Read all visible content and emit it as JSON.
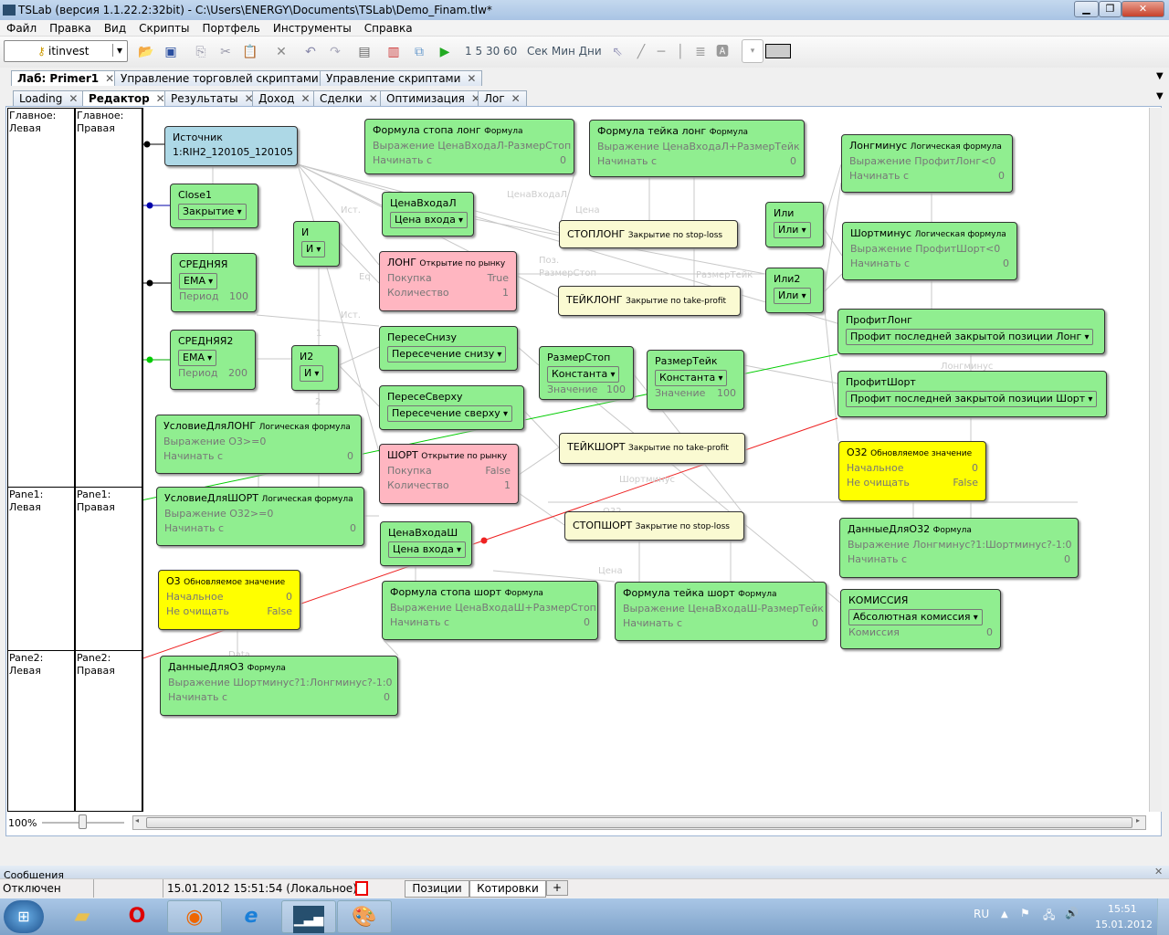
{
  "window": {
    "title": "TSLab (версия 1.1.22.2:32bit) - C:\\Users\\ENERGY\\Documents\\TSLab\\Demo_Finam.tlw*"
  },
  "menu": [
    "Файл",
    "Правка",
    "Вид",
    "Скрипты",
    "Портфель",
    "Инструменты",
    "Справка"
  ],
  "toolbar": {
    "broker": "itinvest",
    "intervals": [
      "1",
      "5",
      "30",
      "60"
    ],
    "units": [
      "Сек",
      "Мин",
      "Дни"
    ]
  },
  "doc_tabs": [
    {
      "label": "Лаб: Primer1",
      "active": true
    },
    {
      "label": "Управление торговлей скриптами"
    },
    {
      "label": "Управление скриптами"
    }
  ],
  "sub_tabs": [
    {
      "label": "Loading"
    },
    {
      "label": "Редактор",
      "active": true
    },
    {
      "label": "Результаты"
    },
    {
      "label": "Доход"
    },
    {
      "label": "Сделки"
    },
    {
      "label": "Оптимизация"
    },
    {
      "label": "Лог"
    }
  ],
  "panes": [
    {
      "title": "Главное:",
      "side": "Левая"
    },
    {
      "title": "Главное:",
      "side": "Правая"
    },
    {
      "title": "Pane1:",
      "side": "Левая"
    },
    {
      "title": "Pane1:",
      "side": "Правая"
    },
    {
      "title": "Pane2:",
      "side": "Левая"
    },
    {
      "title": "Pane2:",
      "side": "Правая"
    }
  ],
  "nodes": [
    {
      "id": "src",
      "kind": "blue",
      "title": "Источник",
      "lines": [
        "1:RIH2_120105_120105"
      ]
    },
    {
      "id": "close1",
      "kind": "green",
      "title": "Close1",
      "dropdown": "Закрытие"
    },
    {
      "id": "sred",
      "kind": "green",
      "title": "СРЕДНЯЯ",
      "dropdown": "EMA",
      "props": [
        [
          "Период",
          "100"
        ]
      ]
    },
    {
      "id": "sred2",
      "kind": "green",
      "title": "СРЕДНЯЯ2",
      "dropdown": "EMA",
      "props": [
        [
          "Период",
          "200"
        ]
      ]
    },
    {
      "id": "i",
      "kind": "green",
      "title": "И",
      "dropdown": "И"
    },
    {
      "id": "i2",
      "kind": "green",
      "title": "И2",
      "dropdown": "И"
    },
    {
      "id": "cenaVL",
      "kind": "green",
      "title": "ЦенаВходаЛ",
      "dropdown": "Цена входа"
    },
    {
      "id": "long",
      "kind": "pink",
      "title": "ЛОНГ",
      "sub": "Открытие по рынку",
      "props": [
        [
          "Покупка",
          "True"
        ],
        [
          "Количество",
          "1"
        ]
      ]
    },
    {
      "id": "pereSn",
      "kind": "green",
      "title": "ПересеСнизу",
      "dropdown": "Пересечение снизу"
    },
    {
      "id": "pereSv",
      "kind": "green",
      "title": "ПересеСверху",
      "dropdown": "Пересечение сверху"
    },
    {
      "id": "usLong",
      "kind": "green",
      "title": "УсловиеДляЛОНГ",
      "sub": "Логическая формула",
      "props": [
        [
          "Выражение О3>=0",
          ""
        ],
        [
          "Начинать с",
          "0"
        ]
      ]
    },
    {
      "id": "usShort",
      "kind": "green",
      "title": "УсловиеДляШОРТ",
      "sub": "Логическая формула",
      "props": [
        [
          "Выражение О32>=0",
          ""
        ],
        [
          "Начинать с",
          "0"
        ]
      ]
    },
    {
      "id": "short",
      "kind": "pink",
      "title": "ШОРТ",
      "sub": "Открытие по рынку",
      "props": [
        [
          "Покупка",
          "False"
        ],
        [
          "Количество",
          "1"
        ]
      ]
    },
    {
      "id": "cenaVSh",
      "kind": "green",
      "title": "ЦенаВходаШ",
      "dropdown": "Цена входа"
    },
    {
      "id": "fStopL",
      "kind": "green",
      "title": "Формула стопа лонг",
      "sub": "Формула",
      "props": [
        [
          "Выражение ЦенаВходаЛ-РазмерСтоп",
          ""
        ],
        [
          "Начинать с",
          "0"
        ]
      ]
    },
    {
      "id": "fTakeL",
      "kind": "green",
      "title": "Формула тейка лонг",
      "sub": "Формула",
      "props": [
        [
          "Выражение ЦенаВходаЛ+РазмерТейк",
          ""
        ],
        [
          "Начинать с",
          "0"
        ]
      ]
    },
    {
      "id": "stopLong",
      "kind": "cream",
      "title": "СТОПЛОНГ",
      "sub": "Закрытие по stop-loss"
    },
    {
      "id": "takeLong",
      "kind": "cream",
      "title": "ТЕЙКЛОНГ",
      "sub": "Закрытие по take-profit"
    },
    {
      "id": "razmStop",
      "kind": "green",
      "title": "РазмерСтоп",
      "dropdown": "Константа",
      "props": [
        [
          "Значение",
          "100"
        ]
      ]
    },
    {
      "id": "razmTake",
      "kind": "green",
      "title": "РазмерТейк",
      "dropdown": "Константа",
      "props": [
        [
          "Значение",
          "100"
        ]
      ]
    },
    {
      "id": "takeShort",
      "kind": "cream",
      "title": "ТЕЙКШОРТ",
      "sub": "Закрытие по take-profit"
    },
    {
      "id": "stopShort",
      "kind": "cream",
      "title": "СТОПШОРТ",
      "sub": "Закрытие по stop-loss"
    },
    {
      "id": "ili",
      "kind": "green",
      "title": "Или",
      "dropdown": "Или"
    },
    {
      "id": "ili2",
      "kind": "green",
      "title": "Или2",
      "dropdown": "Или"
    },
    {
      "id": "longMinus",
      "kind": "green",
      "title": "Лонгминус",
      "sub": "Логическая формула",
      "props": [
        [
          "Выражение ПрофитЛонг<0",
          ""
        ],
        [
          "Начинать с",
          "0"
        ]
      ]
    },
    {
      "id": "shortMinus",
      "kind": "green",
      "title": "Шортминус",
      "sub": "Логическая формула",
      "props": [
        [
          "Выражение ПрофитШорт<0",
          ""
        ],
        [
          "Начинать с",
          "0"
        ]
      ]
    },
    {
      "id": "profitLong",
      "kind": "green",
      "title": "ПрофитЛонг",
      "dropdown": "Профит последней закрытой позиции Лонг"
    },
    {
      "id": "profitShort",
      "kind": "green",
      "title": "ПрофитШорт",
      "dropdown": "Профит последней закрытой позиции Шорт"
    },
    {
      "id": "oz2",
      "kind": "yellow",
      "title": "О32",
      "sub": "Обновляемое значение",
      "props": [
        [
          "Начальное",
          "0"
        ],
        [
          "Не очищать",
          "False"
        ]
      ]
    },
    {
      "id": "data2",
      "kind": "green",
      "title": "ДанныеДляО32",
      "sub": "Формула",
      "props": [
        [
          "Выражение Лонгминус?1:Шортминус?-1:0",
          ""
        ],
        [
          "Начинать с",
          "0"
        ]
      ]
    },
    {
      "id": "komissiya",
      "kind": "green",
      "title": "КОМИССИЯ",
      "dropdown": "Абсолютная комиссия",
      "props": [
        [
          "Комиссия",
          "0"
        ]
      ]
    },
    {
      "id": "oz",
      "kind": "yellow",
      "title": "О3",
      "sub": "Обновляемое значение",
      "props": [
        [
          "Начальное",
          "0"
        ],
        [
          "Не очищать",
          "False"
        ]
      ]
    },
    {
      "id": "fStopSh",
      "kind": "green",
      "title": "Формула стопа шорт",
      "sub": "Формула",
      "props": [
        [
          "Выражение ЦенаВходаШ+РазмерСтоп",
          ""
        ],
        [
          "Начинать с",
          "0"
        ]
      ]
    },
    {
      "id": "fTakeSh",
      "kind": "green",
      "title": "Формула тейка шорт",
      "sub": "Формула",
      "props": [
        [
          "Выражение ЦенаВходаШ-РазмерТейк",
          ""
        ],
        [
          "Начинать с",
          "0"
        ]
      ]
    },
    {
      "id": "data1",
      "kind": "green",
      "title": "ДанныеДляО3",
      "sub": "Формула",
      "props": [
        [
          "Выражение Шортминус?1:Лонгминус?-1:0",
          ""
        ],
        [
          "Начинать с",
          "0"
        ]
      ]
    }
  ],
  "edge_labels": [
    "Ист.",
    "Eq",
    "ЦенаВходаЛ",
    "Цена",
    "Поз.",
    "РазмерСтоп",
    "РазмерТейк",
    "Лонгминус",
    "Шортминус",
    "О32",
    "Data",
    "Цена",
    "Ист.",
    "1",
    "2"
  ],
  "zoom": {
    "label": "100%",
    "level": 0.5
  },
  "messages_label": "Сообщения",
  "status": {
    "connection": "Отключен",
    "datetime": "15.01.2012 15:51:54 (Локальное)",
    "tabs": [
      "Позиции",
      "Котировки"
    ],
    "add": "+"
  },
  "taskbar": {
    "lang": "RU",
    "time": "15:51",
    "date": "15.01.2012"
  },
  "colors": {
    "green_node": "#90ee90",
    "pink_node": "#ffb6c1",
    "cream_node": "#fafad2",
    "yellow_node": "#ffff00",
    "source_node": "#add8e6",
    "green_link": "#00cc00",
    "red_link": "#ee2222"
  }
}
